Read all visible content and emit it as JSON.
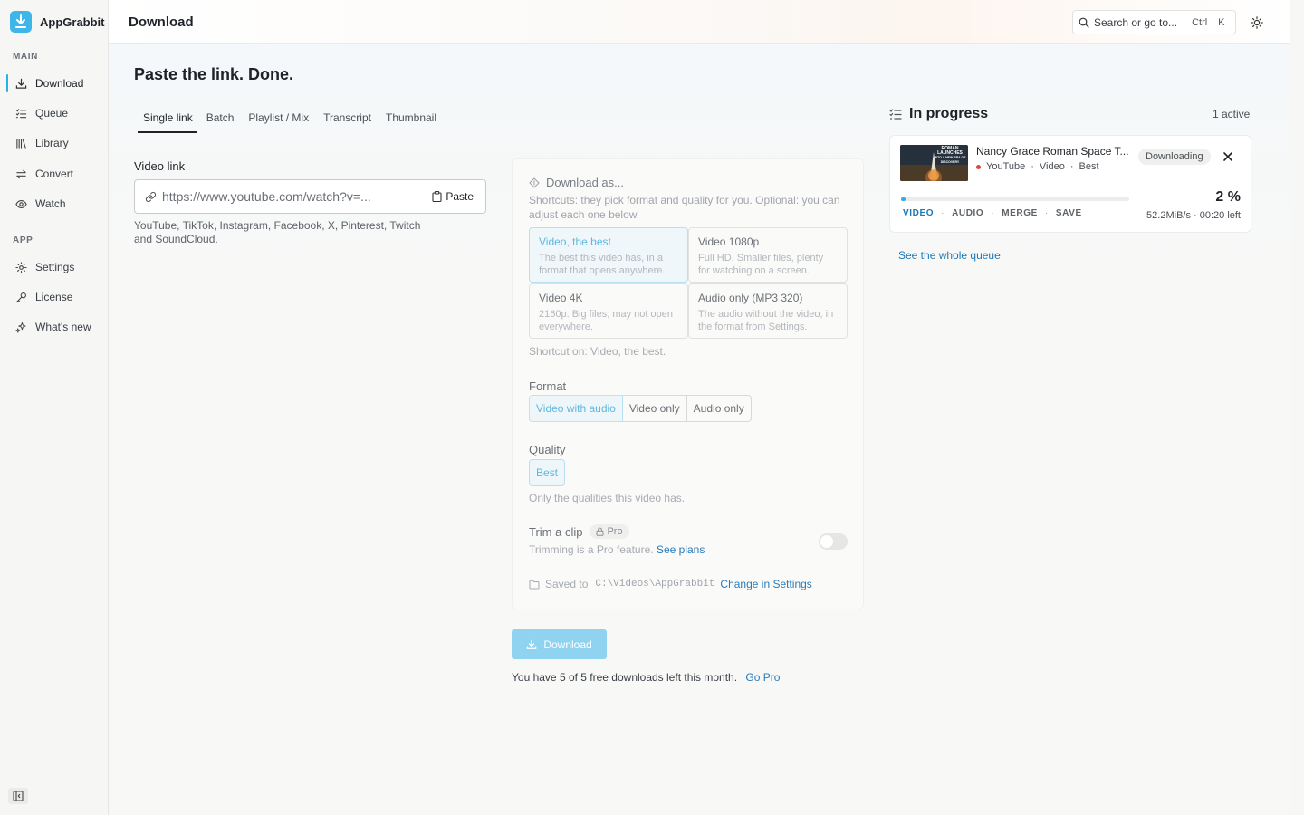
{
  "app": {
    "name": "AppGrabbit"
  },
  "sidebar": {
    "sections": [
      {
        "label": "MAIN"
      },
      {
        "label": "APP"
      }
    ],
    "main_items": [
      {
        "label": "Download",
        "icon": "download-icon",
        "active": true
      },
      {
        "label": "Queue",
        "icon": "queue-icon"
      },
      {
        "label": "Library",
        "icon": "library-icon"
      },
      {
        "label": "Convert",
        "icon": "convert-icon"
      },
      {
        "label": "Watch",
        "icon": "eye-icon"
      }
    ],
    "app_items": [
      {
        "label": "Settings",
        "icon": "gear-icon"
      },
      {
        "label": "License",
        "icon": "key-icon"
      },
      {
        "label": "What's new",
        "icon": "sparkle-icon"
      }
    ]
  },
  "header": {
    "title": "Download",
    "search_placeholder": "Search or go to...",
    "shortcut_mod": "Ctrl",
    "shortcut_key": "K"
  },
  "main": {
    "title": "Paste the link. Done.",
    "tabs": [
      {
        "label": "Single link",
        "active": true
      },
      {
        "label": "Batch"
      },
      {
        "label": "Playlist / Mix"
      },
      {
        "label": "Transcript"
      },
      {
        "label": "Thumbnail"
      }
    ],
    "video_link_label": "Video link",
    "video_link_placeholder": "https://www.youtube.com/watch?v=...",
    "paste_label": "Paste",
    "supported_sites": "YouTube, TikTok, Instagram, Facebook, X, Pinterest, Twitch and SoundCloud."
  },
  "download_as": {
    "title": "Download as...",
    "subtitle": "Shortcuts: they pick format and quality for you. Optional: you can adjust each one below.",
    "presets": [
      {
        "title": "Video, the best",
        "desc": "The best this video has, in a format that opens anywhere.",
        "selected": true
      },
      {
        "title": "Video 1080p",
        "desc": "Full HD. Smaller files, plenty for watching on a screen."
      },
      {
        "title": "Video 4K",
        "desc": "2160p. Big files; may not open everywhere."
      },
      {
        "title": "Audio only (MP3 320)",
        "desc": "The audio without the video, in the format from Settings."
      }
    ],
    "shortcut_on": "Shortcut on: Video, the best.",
    "format_label": "Format",
    "format_options": [
      {
        "label": "Video with audio",
        "selected": true
      },
      {
        "label": "Video only"
      },
      {
        "label": "Audio only"
      }
    ],
    "quality_label": "Quality",
    "quality_value": "Best",
    "quality_help": "Only the qualities this video has.",
    "trim_label": "Trim a clip",
    "pro_badge": "Pro",
    "trim_help": "Trimming is a Pro feature.",
    "see_plans": "See plans",
    "trim_enabled": false,
    "saved_to_label": "Saved to",
    "saved_path": "C:\\Videos\\AppGrabbit",
    "change_settings": "Change in Settings"
  },
  "download_button": "Download",
  "free_note": "You have 5 of 5 free downloads left this month.",
  "go_pro": "Go Pro",
  "in_progress": {
    "title": "In progress",
    "count": "1 active",
    "job": {
      "title": "Nancy Grace Roman Space T...",
      "thumb_text_line1": "ROMAN LAUNCHES",
      "thumb_text_line2": "INTO A NEW ERA OF DISCOVERY",
      "source": "YouTube",
      "kind": "Video",
      "quality": "Best",
      "status": "Downloading",
      "progress_percent": 2,
      "percent_label": "2 %",
      "stages": [
        "VIDEO",
        "AUDIO",
        "MERGE",
        "SAVE"
      ],
      "active_stage": "VIDEO",
      "speed": "52.2MiB/s · 00:20 left"
    },
    "queue_link": "See the whole queue"
  },
  "colors": {
    "accent": "#2ab0e6",
    "link": "#1b79b5",
    "download_button": "#8fd3f1"
  }
}
